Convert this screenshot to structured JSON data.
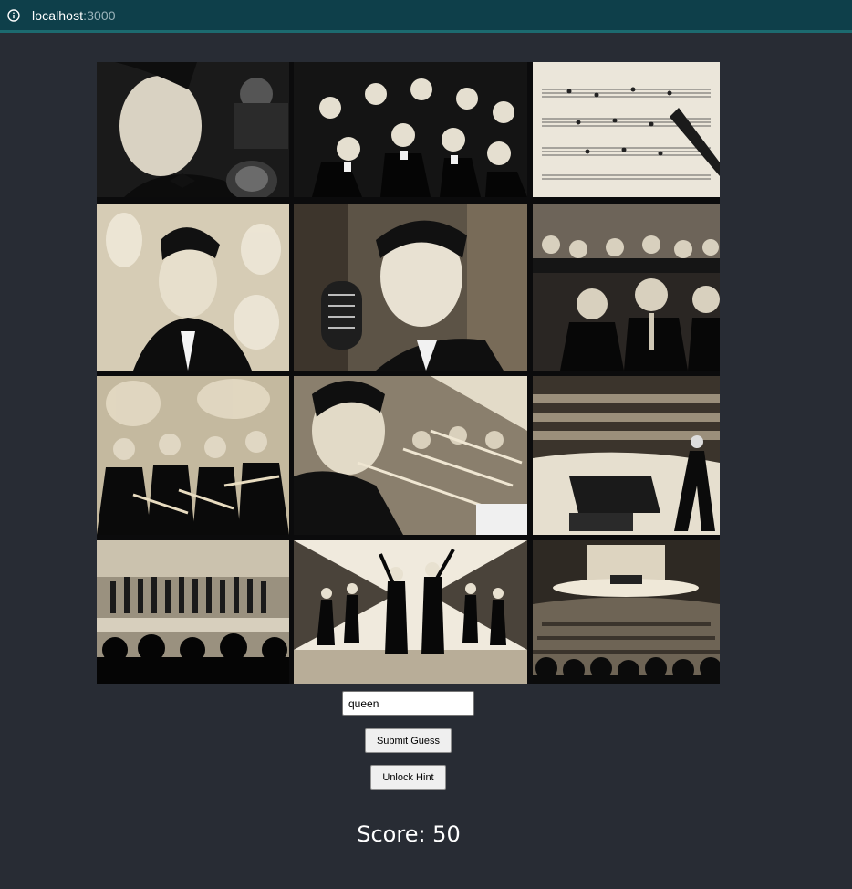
{
  "browser": {
    "url_host": "localhost",
    "url_port": ":3000",
    "info_icon": "info-icon"
  },
  "gallery": {
    "tiles": [
      {
        "icon": "singer-with-microphone-image"
      },
      {
        "icon": "choir-group-image"
      },
      {
        "icon": "sheet-music-image"
      },
      {
        "icon": "singer-with-dancers-image"
      },
      {
        "icon": "singer-at-vintage-microphone-image"
      },
      {
        "icon": "musicians-in-tuxedos-image"
      },
      {
        "icon": "trumpet-section-image"
      },
      {
        "icon": "trombone-player-image"
      },
      {
        "icon": "concert-hall-pianist-image"
      },
      {
        "icon": "orchestra-on-stage-image"
      },
      {
        "icon": "performers-bowing-image"
      },
      {
        "icon": "concert-hall-audience-image"
      }
    ]
  },
  "guess": {
    "value": "queen"
  },
  "buttons": {
    "submit_label": "Submit Guess",
    "hint_label": "Unlock Hint"
  },
  "score": {
    "label": "Score: 50"
  },
  "colors": {
    "page_background": "#282c34",
    "address_bar": "#0e3f4a",
    "address_bar_accent": "#1c6a6f",
    "tile_sepia": "#e9e1cf"
  }
}
